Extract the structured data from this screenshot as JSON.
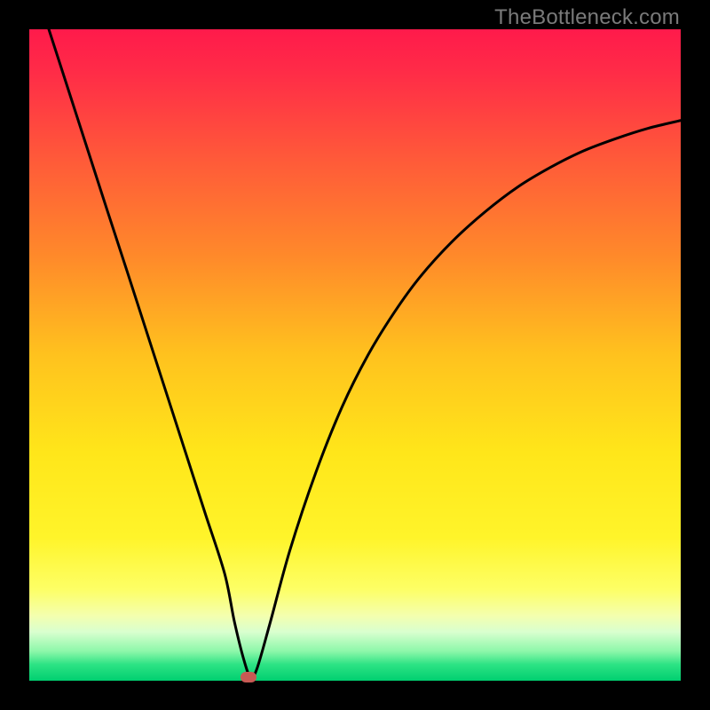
{
  "watermark": {
    "text": "TheBottleneck.com"
  },
  "chart_data": {
    "type": "line",
    "title": "",
    "xlabel": "",
    "ylabel": "",
    "xlim": [
      0,
      100
    ],
    "ylim": [
      0,
      100
    ],
    "gradient_stops": [
      {
        "offset": 0.0,
        "color": "#ff1a4b"
      },
      {
        "offset": 0.07,
        "color": "#ff2d47"
      },
      {
        "offset": 0.2,
        "color": "#ff5a39"
      },
      {
        "offset": 0.35,
        "color": "#ff8a2a"
      },
      {
        "offset": 0.5,
        "color": "#ffc21e"
      },
      {
        "offset": 0.65,
        "color": "#ffe61a"
      },
      {
        "offset": 0.78,
        "color": "#fff42a"
      },
      {
        "offset": 0.86,
        "color": "#fdff66"
      },
      {
        "offset": 0.9,
        "color": "#f4ffae"
      },
      {
        "offset": 0.925,
        "color": "#d9ffcf"
      },
      {
        "offset": 0.955,
        "color": "#8cf7a9"
      },
      {
        "offset": 0.975,
        "color": "#2de384"
      },
      {
        "offset": 1.0,
        "color": "#00cf70"
      }
    ],
    "series": [
      {
        "name": "bottleneck-curve",
        "x": [
          3,
          6,
          9,
          12,
          15,
          18,
          21,
          24,
          27,
          30,
          31.5,
          33,
          34,
          35,
          37,
          40,
          44,
          48,
          52,
          56,
          60,
          65,
          70,
          75,
          80,
          85,
          90,
          95,
          100
        ],
        "y": [
          100,
          90.7,
          81.4,
          72.1,
          62.9,
          53.6,
          44.3,
          35,
          25.7,
          16.4,
          9,
          3,
          0.5,
          2,
          9,
          20,
          32,
          42,
          50,
          56.5,
          62,
          67.5,
          72,
          75.8,
          78.8,
          81.3,
          83.2,
          84.8,
          86
        ]
      }
    ],
    "marker": {
      "x": 33.7,
      "y": 0.6,
      "color": "#c85a54"
    }
  }
}
